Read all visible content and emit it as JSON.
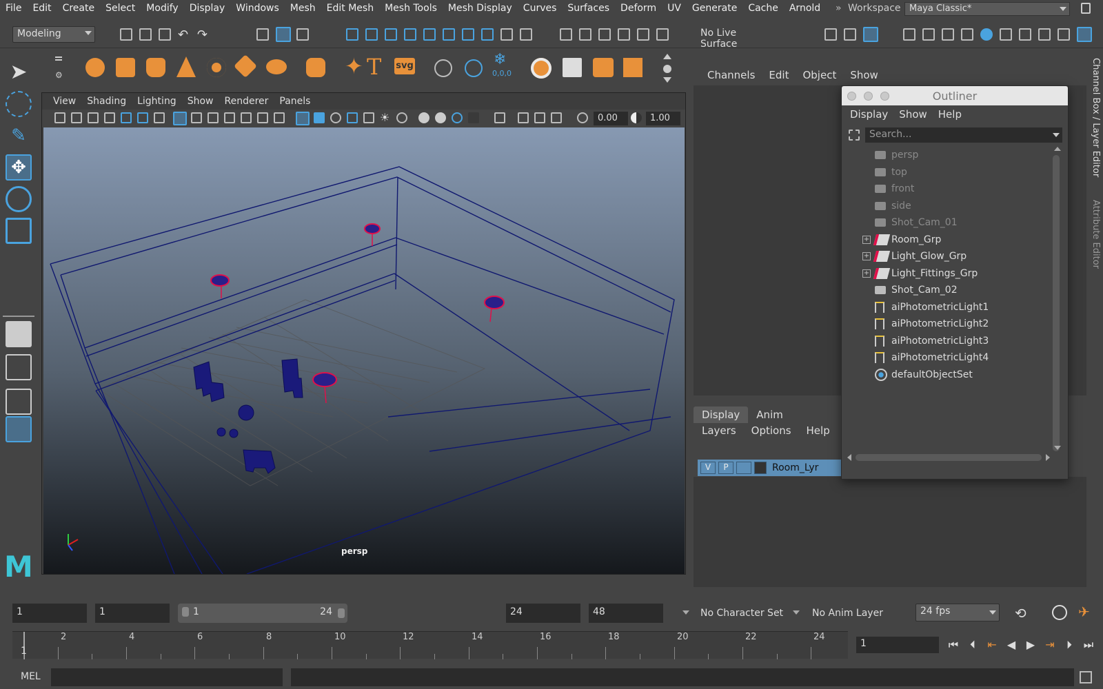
{
  "menubar": {
    "items": [
      "File",
      "Edit",
      "Create",
      "Select",
      "Modify",
      "Display",
      "Windows",
      "Mesh",
      "Edit Mesh",
      "Mesh Tools",
      "Mesh Display",
      "Curves",
      "Surfaces",
      "Deform",
      "UV",
      "Generate",
      "Cache",
      "Arnold"
    ],
    "workspace_label": "Workspace :",
    "workspace_value": "Maya Classic*"
  },
  "statusline": {
    "mode": "Modeling",
    "live_surface": "No Live Surface"
  },
  "shelf": {
    "text_tool_glyph": "T",
    "svg_tool_label": "svg",
    "coords_label": "0,0,0"
  },
  "viewport": {
    "menu": [
      "View",
      "Shading",
      "Lighting",
      "Show",
      "Renderer",
      "Panels"
    ],
    "exposure": "0.00",
    "gamma": "1.00",
    "camera_label": "persp"
  },
  "channel_box": {
    "menu": [
      "Channels",
      "Edit",
      "Object",
      "Show"
    ]
  },
  "layer_editor": {
    "tabs": [
      "Display",
      "Anim"
    ],
    "menu": [
      "Layers",
      "Options",
      "Help"
    ],
    "layer": {
      "v": "V",
      "p": "P",
      "name": "Room_Lyr"
    }
  },
  "side_tabs": [
    "Channel Box / Layer Editor",
    "Attribute Editor"
  ],
  "outliner": {
    "title": "Outliner",
    "menu": [
      "Display",
      "Show",
      "Help"
    ],
    "search_placeholder": "Search...",
    "items": [
      {
        "label": "persp",
        "kind": "camera",
        "dim": true
      },
      {
        "label": "top",
        "kind": "camera",
        "dim": true
      },
      {
        "label": "front",
        "kind": "camera",
        "dim": true
      },
      {
        "label": "side",
        "kind": "camera",
        "dim": true
      },
      {
        "label": "Shot_Cam_01",
        "kind": "camera",
        "dim": true
      },
      {
        "label": "Room_Grp",
        "kind": "group",
        "dim": false
      },
      {
        "label": "Light_Glow_Grp",
        "kind": "group",
        "dim": false
      },
      {
        "label": "Light_Fittings_Grp",
        "kind": "group",
        "dim": false
      },
      {
        "label": "Shot_Cam_02",
        "kind": "camera",
        "dim": false
      },
      {
        "label": "aiPhotometricLight1",
        "kind": "light",
        "dim": false
      },
      {
        "label": "aiPhotometricLight2",
        "kind": "light",
        "dim": false
      },
      {
        "label": "aiPhotometricLight3",
        "kind": "light",
        "dim": false
      },
      {
        "label": "aiPhotometricLight4",
        "kind": "light",
        "dim": false
      },
      {
        "label": "defaultObjectSet",
        "kind": "set",
        "dim": false
      }
    ]
  },
  "range": {
    "start": "1",
    "playback_start": "1",
    "slider_start": "1",
    "slider_end": "24",
    "playback_end": "24",
    "end": "48",
    "character_set": "No Character Set",
    "anim_layer": "No Anim Layer",
    "fps": "24 fps"
  },
  "timeline": {
    "current_frame_label": "1",
    "ticks": [
      "2",
      "4",
      "6",
      "8",
      "10",
      "12",
      "14",
      "16",
      "18",
      "20",
      "22",
      "24"
    ],
    "current_frame_field": "1"
  },
  "command_line": {
    "lang": "MEL"
  },
  "colors": {
    "accent": "#4aa3df",
    "shelf_orange": "#e8913a",
    "layer_blue": "#5d8fb8"
  }
}
